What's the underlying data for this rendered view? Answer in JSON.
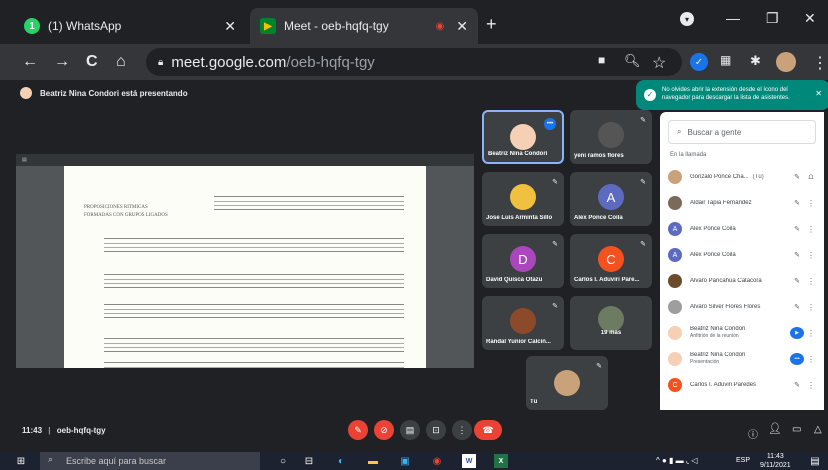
{
  "browser": {
    "tabs": [
      {
        "title": "(1) WhatsApp",
        "icon": "whatsapp-icon"
      },
      {
        "title": "Meet - oeb-hqfq-tgy",
        "icon": "meet-icon"
      }
    ],
    "url_host": "meet.google.com",
    "url_path": "/oeb-hqfq-tgy"
  },
  "presenting_banner": "Beatriz Nina Condori está presentando",
  "tooltip": "No olvides abrir la extensión desde el ícono del navegador para descargar la lista de asistentes.",
  "shared_screen": {
    "heading_line1": "PROPOSICIONES RITMICAS",
    "heading_line2": "FORMADAS CON GRUPOS LIGADOS"
  },
  "tiles": [
    {
      "name": "Beatriz Nina Condori",
      "initial": "",
      "color": "#f5d0b5"
    },
    {
      "name": "yeni ramos flores",
      "initial": "",
      "color": "#555"
    },
    {
      "name": "Jose Luis Arminta Sillo",
      "initial": "",
      "color": "#f0c040"
    },
    {
      "name": "Alex Ponce Coila",
      "initial": "A",
      "color": "#5c6bc0"
    },
    {
      "name": "David Quisca Otazu",
      "initial": "D",
      "color": "#ab47bc"
    },
    {
      "name": "Carlos I. Aduviri Pare...",
      "initial": "C",
      "color": "#f4511e"
    },
    {
      "name": "Randal Yunior Calcin...",
      "initial": "",
      "color": "#8d4a2a"
    },
    {
      "name": "19 más",
      "initial": "",
      "color": "#6d7b63"
    },
    {
      "name": "Tú",
      "initial": "",
      "color": "#c9a27a"
    }
  ],
  "panel": {
    "search_placeholder": "Buscar a gente",
    "section_label": "En la llamada",
    "people": [
      {
        "name": "Gonzalo Ponce Cha...",
        "suffix": "(Tú)",
        "sub": "",
        "initial": "",
        "color": "#c9a27a"
      },
      {
        "name": "Aldair Tapia Fernández",
        "suffix": "",
        "sub": "",
        "initial": "",
        "color": "#7a6a5a"
      },
      {
        "name": "Alex Ponce Coila",
        "suffix": "",
        "sub": "",
        "initial": "A",
        "color": "#5c6bc0"
      },
      {
        "name": "Alex Ponce Coila",
        "suffix": "",
        "sub": "",
        "initial": "A",
        "color": "#5c6bc0"
      },
      {
        "name": "Alvaro Paricahua Catacora",
        "suffix": "",
        "sub": "",
        "initial": "",
        "color": "#6b4b2b"
      },
      {
        "name": "Alvaro Silver Flores Flores",
        "suffix": "",
        "sub": "",
        "initial": "",
        "color": "#9e9e9e"
      },
      {
        "name": "Beatriz Nina Condori",
        "suffix": "",
        "sub": "Anfitrión de la reunión",
        "initial": "",
        "color": "#f5d0b5"
      },
      {
        "name": "Beatriz Nina Condori",
        "suffix": "",
        "sub": "Presentación",
        "initial": "",
        "color": "#f5d0b5"
      },
      {
        "name": "Carlos I. Aduviri Paredes",
        "suffix": "",
        "sub": "",
        "initial": "C",
        "color": "#f4511e"
      }
    ]
  },
  "meetbar": {
    "time": "11:43",
    "code": "oeb-hqfq-tgy"
  },
  "taskbar": {
    "search_placeholder": "Escribe aquí para buscar",
    "lang": "ESP",
    "time": "11:43",
    "date": "9/11/2021"
  }
}
